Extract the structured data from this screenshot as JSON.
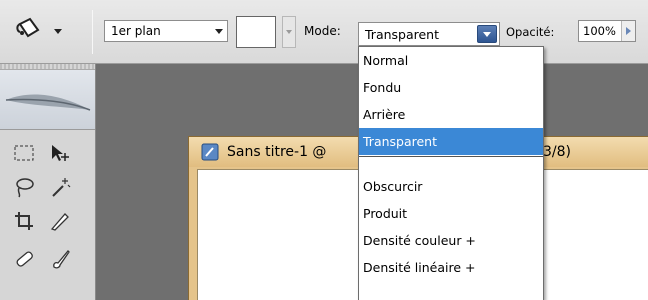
{
  "options_bar": {
    "tool_icon": "paint-bucket-icon",
    "fill_source_value": "1er plan",
    "mode_label": "Mode:",
    "mode_value": "Transparent",
    "opacity_label": "Opacité:",
    "opacity_value": "100%"
  },
  "document": {
    "title": "Sans titre-1 @",
    "title_suffix": "3/8)"
  },
  "mode_dropdown": {
    "options": [
      "Normal",
      "Fondu",
      "Arrière",
      "Transparent",
      "Obscurcir",
      "Produit",
      "Densité couleur +",
      "Densité linéaire +"
    ],
    "selected": "Transparent"
  },
  "colors": {
    "selection": "#3b88d6",
    "document_frame": "#e5c48b"
  }
}
